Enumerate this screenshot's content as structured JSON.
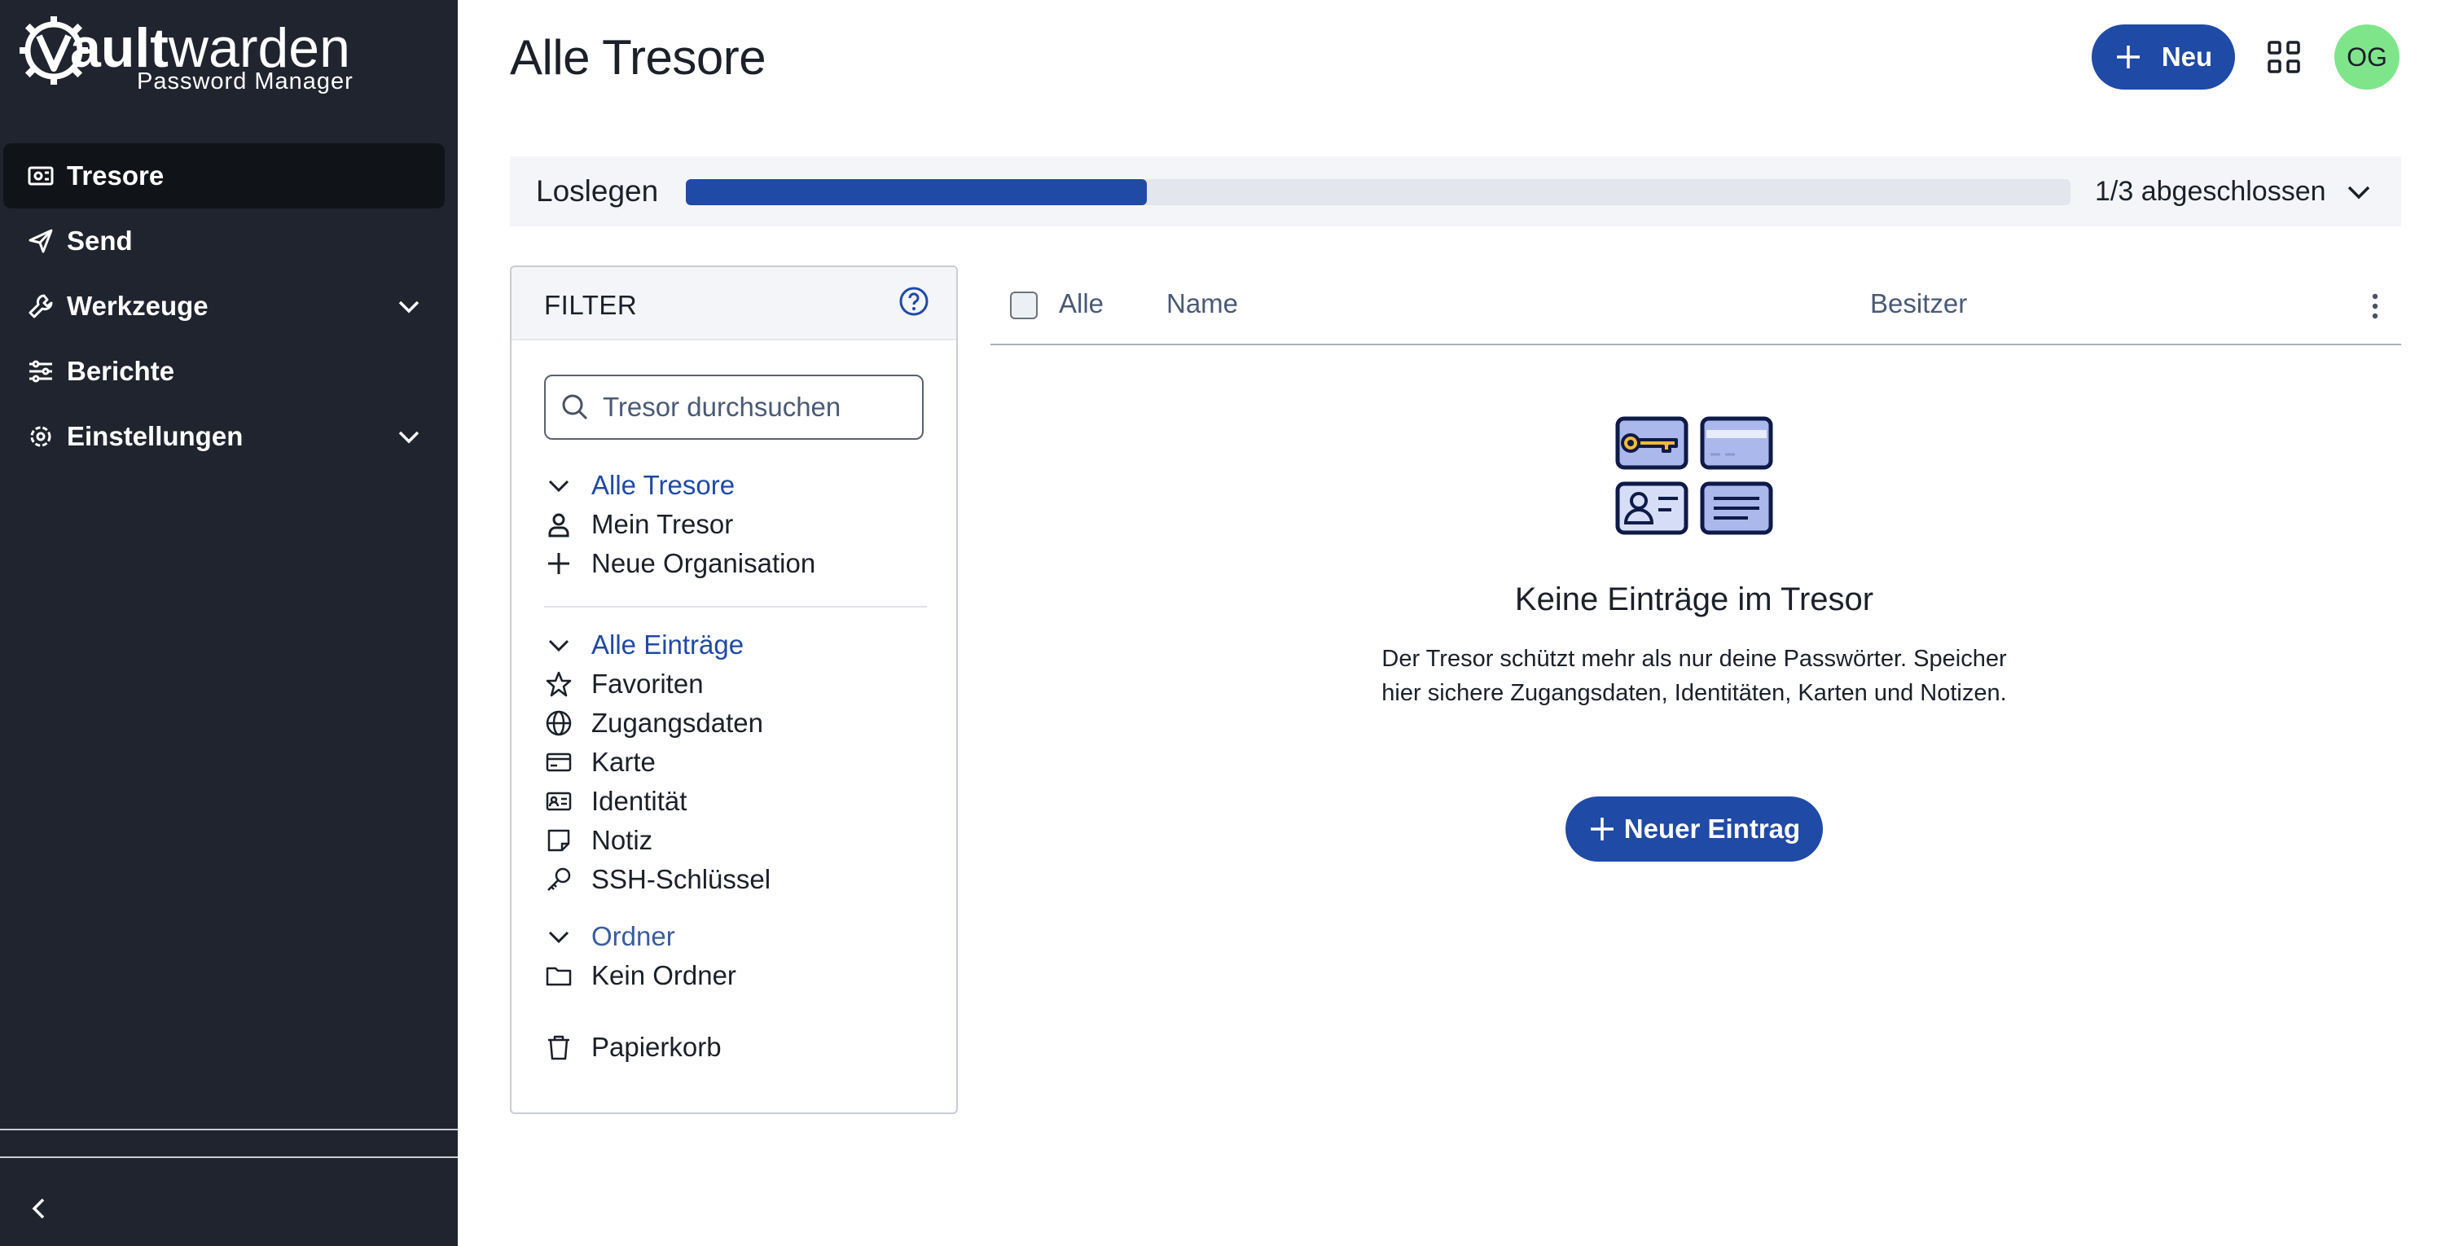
{
  "brand": {
    "name_bold": "ault",
    "name_rest": "warden",
    "subtitle": "Password Manager"
  },
  "sidebar": {
    "items": [
      {
        "label": "Tresore",
        "icon": "vault-icon",
        "active": true
      },
      {
        "label": "Send",
        "icon": "paper-plane-icon"
      },
      {
        "label": "Werkzeuge",
        "icon": "wrench-icon",
        "expandable": true
      },
      {
        "label": "Berichte",
        "icon": "sliders-icon"
      },
      {
        "label": "Einstellungen",
        "icon": "gear-icon",
        "expandable": true
      }
    ]
  },
  "header": {
    "title": "Alle Tresore",
    "new_button": "Neu",
    "avatar_initials": "OG"
  },
  "getting_started": {
    "label": "Loslegen",
    "status": "1/3 abgeschlossen",
    "progress": 0.333
  },
  "filter": {
    "title": "FILTER",
    "search_placeholder": "Tresor durchsuchen",
    "vaults": {
      "heading": "Alle Tresore",
      "items": [
        "Mein Tresor",
        "Neue Organisation"
      ]
    },
    "types": {
      "heading": "Alle Einträge",
      "items": [
        "Favoriten",
        "Zugangsdaten",
        "Karte",
        "Identität",
        "Notiz",
        "SSH-Schlüssel"
      ]
    },
    "folders": {
      "heading": "Ordner",
      "items": [
        "Kein Ordner"
      ]
    },
    "trash": "Papierkorb"
  },
  "table": {
    "col_all": "Alle",
    "col_name": "Name",
    "col_owner": "Besitzer"
  },
  "empty": {
    "title": "Keine Einträge im Tresor",
    "text": "Der Tresor schützt mehr als nur deine Passwörter. Speicher hier sichere Zugangsdaten, Identitäten, Karten und Notizen.",
    "button": "Neuer Eintrag"
  },
  "colors": {
    "sidebar": "#1f242e",
    "primary": "#1f4aa6",
    "avatar": "#7fe58a"
  }
}
